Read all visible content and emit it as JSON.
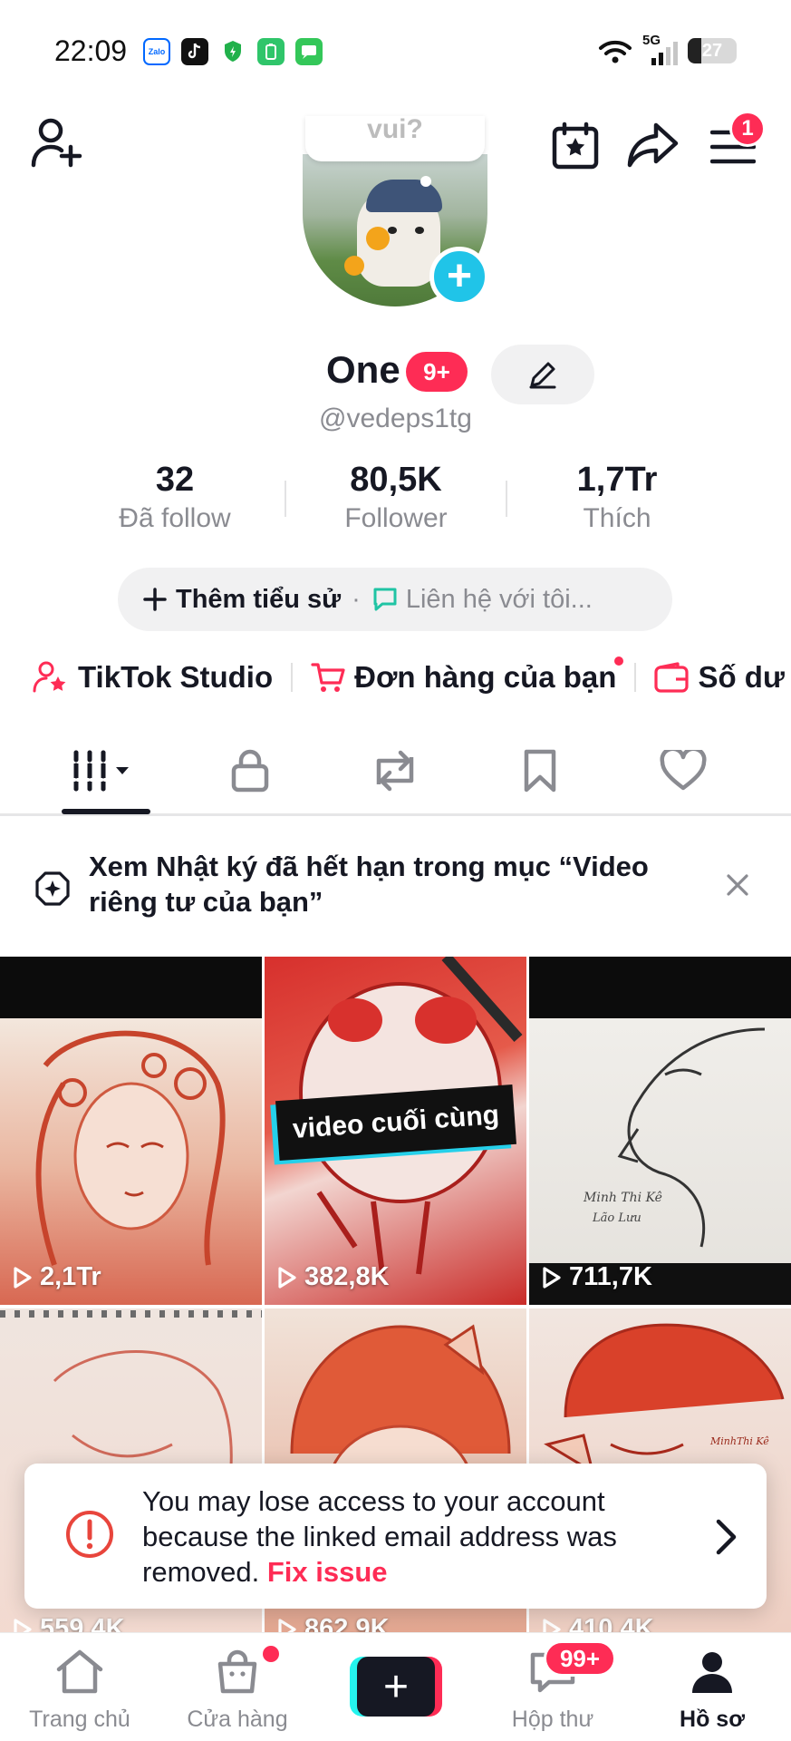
{
  "status_bar": {
    "time": "22:09",
    "apps": [
      {
        "icon": "zalo-icon",
        "label": "Zalo",
        "color": "#0068ff"
      },
      {
        "icon": "tiktok-icon",
        "label": "",
        "color": "#111111"
      },
      {
        "icon": "shield-icon",
        "label": "",
        "color": "#21b14b"
      },
      {
        "icon": "battery-saver-icon",
        "label": "",
        "color": "#2fc56a"
      },
      {
        "icon": "messages-icon",
        "label": "",
        "color": "#34c759"
      }
    ],
    "network": "5G",
    "battery": "27",
    "battery_level": 0.27
  },
  "header": {
    "menu_badge": "1"
  },
  "profile": {
    "bubble_text": "vui?",
    "name": "One",
    "name_badge": "9+",
    "handle": "@vedeps1tg"
  },
  "stats": [
    {
      "value": "32",
      "label": "Đã follow"
    },
    {
      "value": "80,5K",
      "label": "Follower"
    },
    {
      "value": "1,7Tr",
      "label": "Thích"
    }
  ],
  "bio": {
    "add_label": "Thêm tiểu sử",
    "separator": "·",
    "contact_label": "Liên hệ với tôi..."
  },
  "shortcuts": [
    {
      "label": "TikTok Studio"
    },
    {
      "label": "Đơn hàng của bạn"
    },
    {
      "label": "Số dư"
    }
  ],
  "notice": {
    "text": "Xem Nhật ký đã hết hạn trong mục “Video riêng tư của bạn”"
  },
  "videos": [
    {
      "views": "2,1Tr",
      "caption": ""
    },
    {
      "views": "382,8K",
      "caption": "video cuối cùng"
    },
    {
      "views": "711,7K",
      "caption": ""
    },
    {
      "views": "559,4K",
      "caption": ""
    },
    {
      "views": "862,9K",
      "caption": ""
    },
    {
      "views": "410,4K",
      "caption": ""
    }
  ],
  "toast": {
    "message": "You may lose access to your account because the linked email address was removed.",
    "link": "Fix issue"
  },
  "bottom_nav": {
    "home": "Trang chủ",
    "shop": "Cửa hàng",
    "inbox": "Hộp thư",
    "inbox_badge": "99+",
    "profile": "Hồ sơ"
  },
  "colors": {
    "accent": "#fe2c55",
    "cyan": "#25f4ee",
    "text": "#161823",
    "muted": "#8a8b91"
  }
}
